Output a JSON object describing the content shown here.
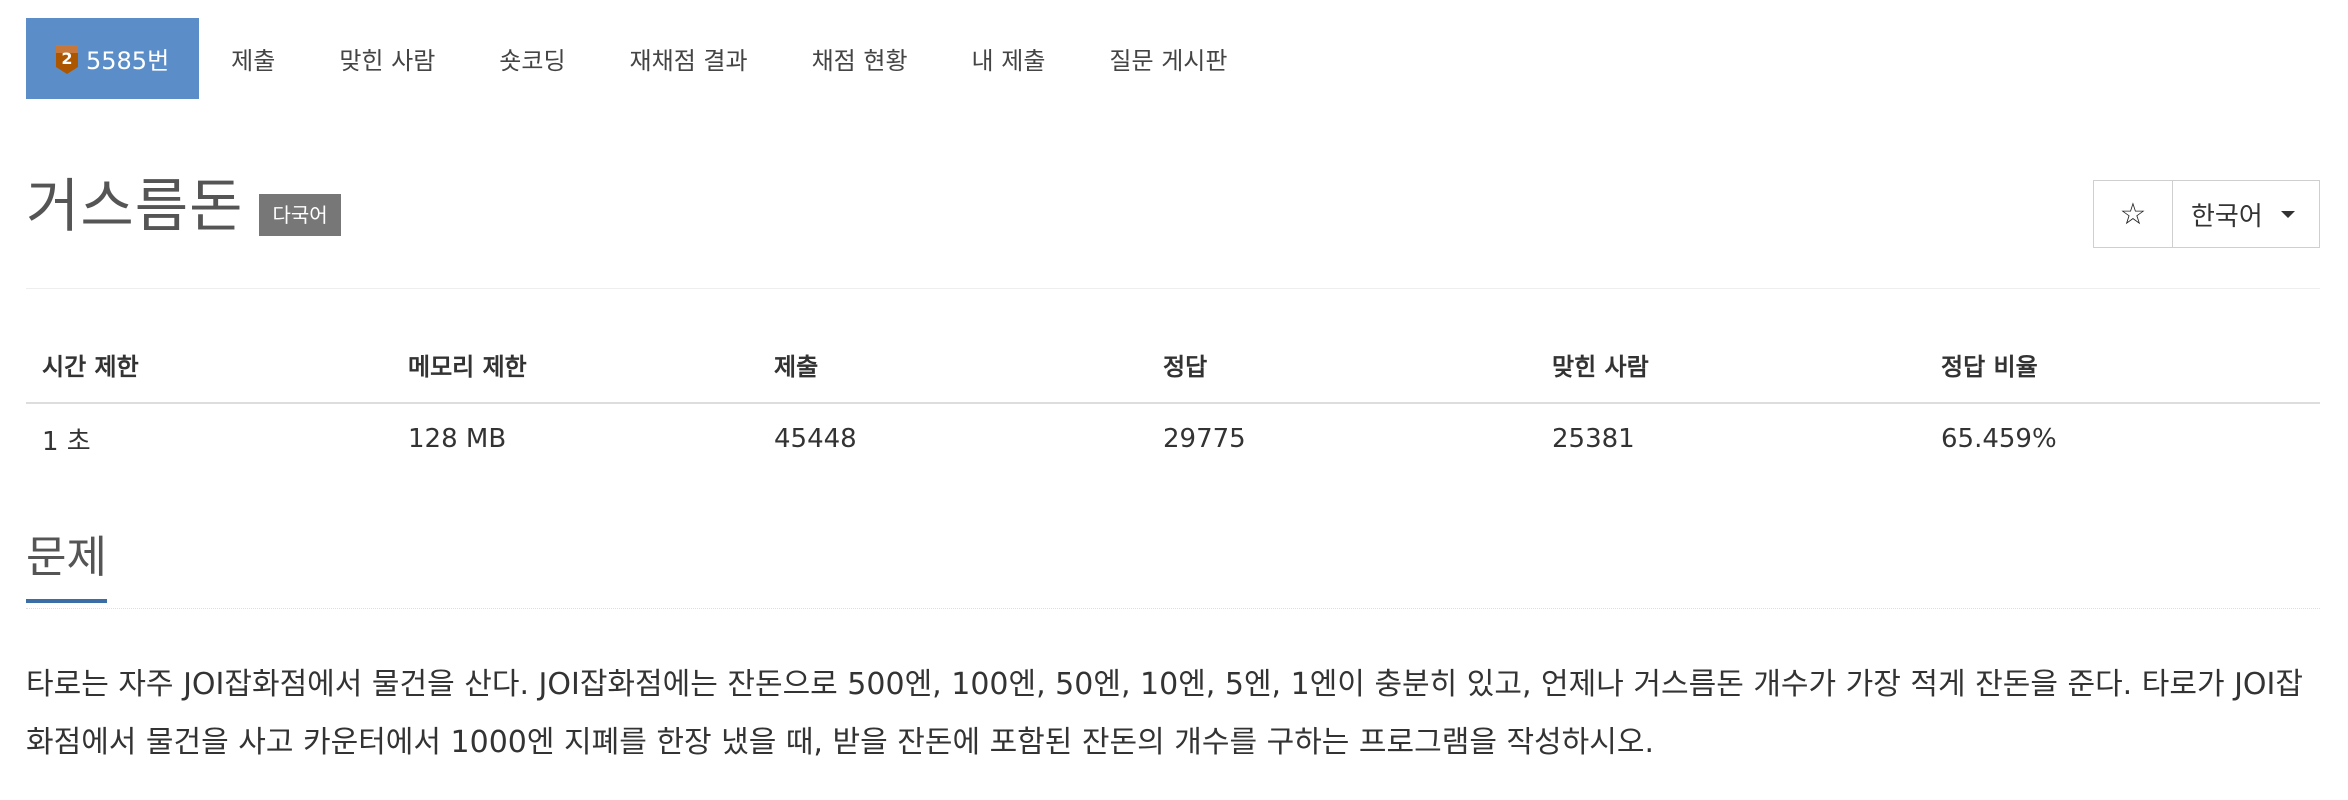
{
  "nav": {
    "problem_tab": "5585번",
    "tier_badge_number": "2",
    "tabs": [
      "제출",
      "맞힌 사람",
      "숏코딩",
      "재채점 결과",
      "채점 현황",
      "내 제출",
      "질문 게시판"
    ]
  },
  "title": {
    "text": "거스름돈",
    "lang_tag": "다국어",
    "star_icon": "☆",
    "language": "한국어"
  },
  "info": {
    "headers": [
      "시간 제한",
      "메모리 제한",
      "제출",
      "정답",
      "맞힌 사람",
      "정답 비율"
    ],
    "values": [
      "1 초",
      "128 MB",
      "45448",
      "29775",
      "25381",
      "65.459%"
    ]
  },
  "section": {
    "title": "문제",
    "text": "타로는 자주 JOI잡화점에서 물건을 산다. JOI잡화점에는 잔돈으로 500엔, 100엔, 50엔, 10엔, 5엔, 1엔이 충분히 있고, 언제나 거스름돈 개수가 가장 적게 잔돈을 준다. 타로가 JOI잡화점에서 물건을 사고 카운터에서 1000엔 지폐를 한장 냈을 때, 받을 잔돈에 포함된 잔돈의 개수를 구하는 프로그램을 작성하시오."
  },
  "colors": {
    "active_tab": "#5b8ec9",
    "section_underline": "#3a6ea5",
    "tag_bg": "#777777",
    "badge_bronze": "#ad5600"
  }
}
